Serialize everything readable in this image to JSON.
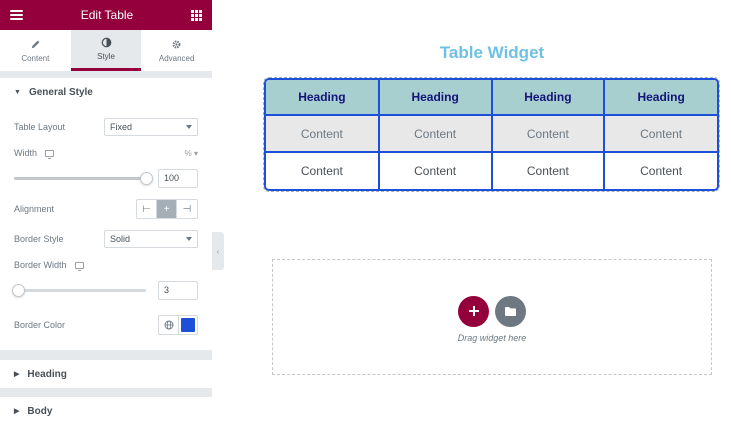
{
  "header": {
    "title": "Edit Table"
  },
  "tabs": [
    {
      "label": "Content",
      "icon": "pencil-icon"
    },
    {
      "label": "Style",
      "icon": "half-circle-icon"
    },
    {
      "label": "Advanced",
      "icon": "gear-icon"
    }
  ],
  "general_style": {
    "title": "General Style",
    "table_layout": {
      "label": "Table Layout",
      "value": "Fixed"
    },
    "width": {
      "label": "Width",
      "unit": "%",
      "value": "100",
      "level": 1.0
    },
    "alignment": {
      "label": "Alignment",
      "options": [
        "⊢",
        "+",
        "⊣"
      ],
      "selected": 1
    },
    "border_style": {
      "label": "Border Style",
      "value": "Solid"
    },
    "border_width": {
      "label": "Border Width",
      "value": "3",
      "level": 0.03
    },
    "border_color": {
      "label": "Border Color",
      "value": "#1e4fd8"
    }
  },
  "sections": {
    "heading": "Heading",
    "body": "Body"
  },
  "canvas": {
    "widget_title": "Table Widget",
    "table": {
      "headers": [
        "Heading",
        "Heading",
        "Heading",
        "Heading"
      ],
      "rows": [
        [
          "Content",
          "Content",
          "Content",
          "Content"
        ],
        [
          "Content",
          "Content",
          "Content",
          "Content"
        ]
      ]
    },
    "drop_text": "Drag widget here",
    "add_icon": "plus-icon",
    "folder_icon": "folder-icon"
  },
  "colors": {
    "brand": "#93003c",
    "title": "#6ec1e4",
    "border": "#1e4fd8",
    "header_bg": "#a8cfcf",
    "header_text": "#13137a",
    "add_button": "#93003c",
    "folder_button": "#6d7882"
  }
}
